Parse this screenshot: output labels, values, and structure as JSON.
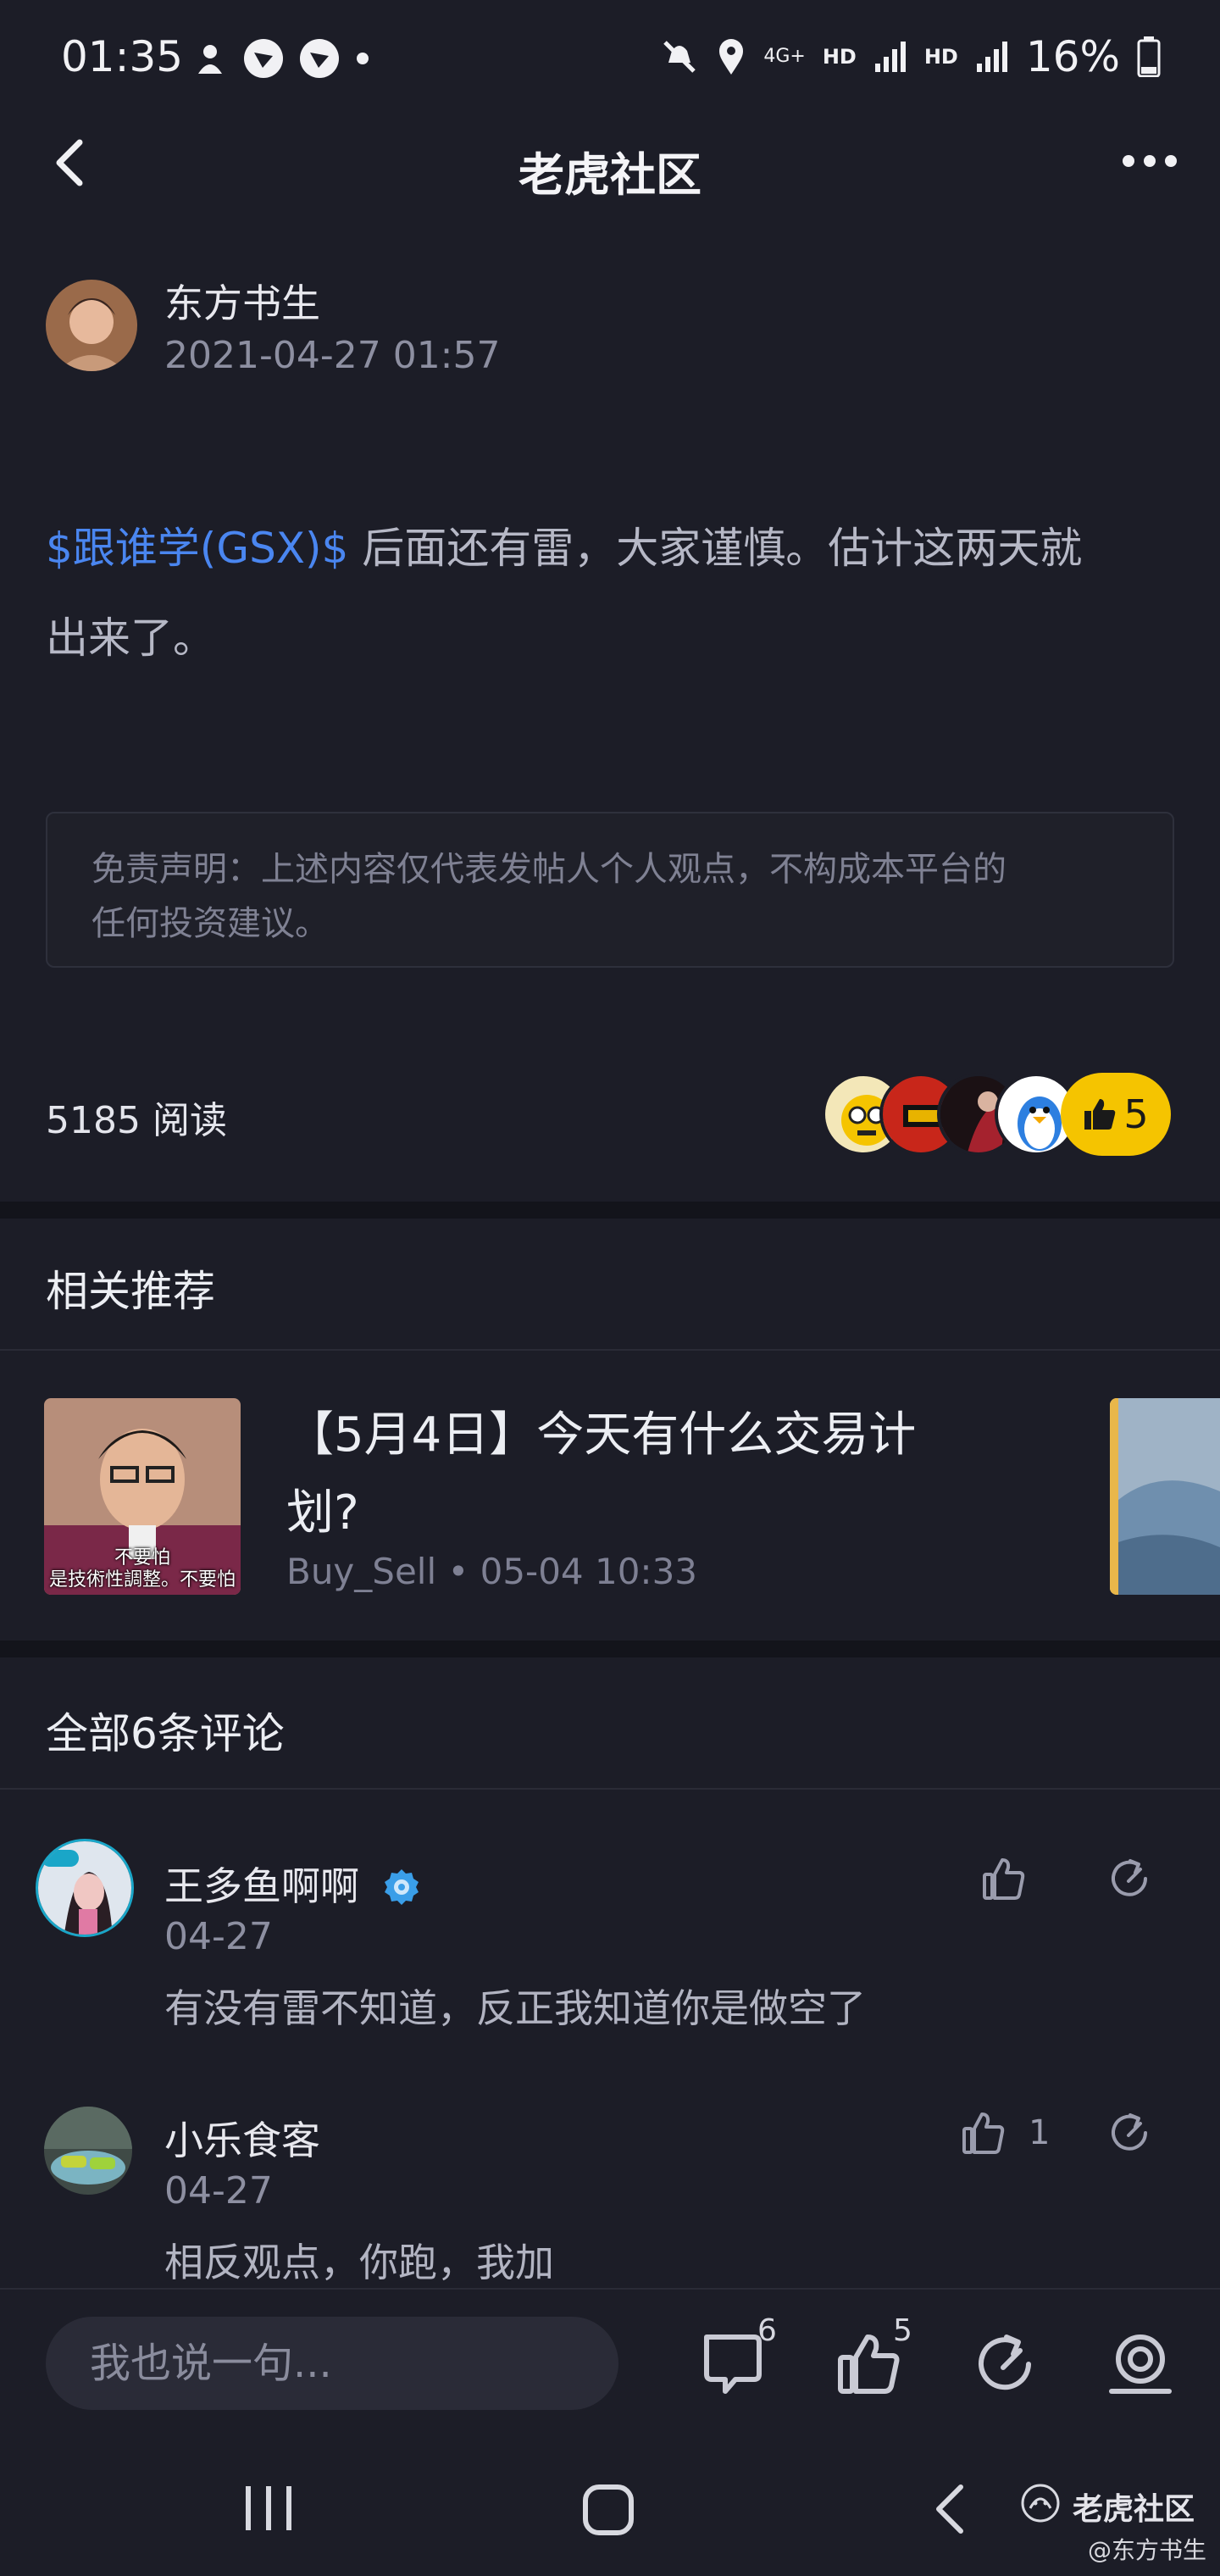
{
  "status_bar": {
    "time": "01:35",
    "network": "4G+",
    "hd1": "HD",
    "hd2": "HD",
    "battery": "16%"
  },
  "nav": {
    "title": "老虎社区"
  },
  "post": {
    "author": "东方书生",
    "timestamp": "2021-04-27 01:57",
    "ticker": "$跟谁学(GSX)$",
    "body_line1": " 后面还有雷，大家谨慎。估计这两天就",
    "body_line2": "出来了。",
    "disclaimer_line1": "免责声明：上述内容仅代表发帖人个人观点，不构成本平台的",
    "disclaimer_line2": "任何投资建议。",
    "read_count": "5185 阅读",
    "like_count": "5"
  },
  "recommend": {
    "section_title": "相关推荐",
    "item_title_line1": "【5月4日】今天有什么交易计",
    "item_title_line2": "划?",
    "item_meta": "Buy_Sell • 05-04 10:33",
    "thumb_caption_line1": "不要怕",
    "thumb_caption_line2": "是技術性調整。不要怕"
  },
  "comments": {
    "section_title": "全部6条评论",
    "items": [
      {
        "name": "王多鱼啊啊",
        "date": "04-27",
        "text": "有没有雷不知道，反正我知道你是做空了",
        "likes": ""
      },
      {
        "name": "小乐食客",
        "date": "04-27",
        "text": "相反观点，你跑，我加",
        "likes": "1"
      }
    ]
  },
  "bottom_bar": {
    "input_placeholder": "我也说一句...",
    "comment_count": "6",
    "like_count": "5"
  },
  "watermark": {
    "name": "老虎社区",
    "sub": "@东方书生"
  },
  "colors": {
    "background": "#1c1d27",
    "ticker": "#4a86f0",
    "like_pill": "#f5c400"
  }
}
